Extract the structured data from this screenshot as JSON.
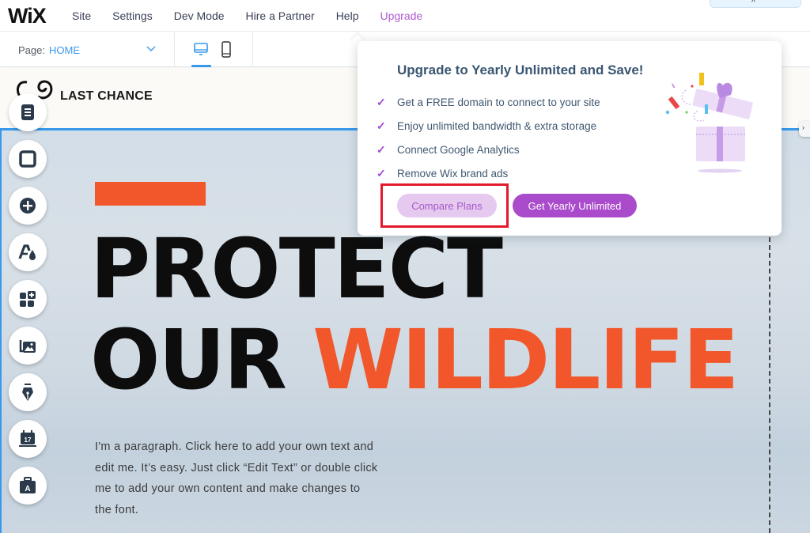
{
  "topbar": {
    "logo": "WiX",
    "menu": [
      {
        "label": "Site"
      },
      {
        "label": "Settings"
      },
      {
        "label": "Dev Mode"
      },
      {
        "label": "Hire a Partner"
      },
      {
        "label": "Help"
      },
      {
        "label": "Upgrade"
      }
    ],
    "collapse_icon": "chevron-up"
  },
  "secondbar": {
    "page_label": "Page:",
    "page_value": "HOME",
    "devices": [
      {
        "name": "desktop",
        "active": true
      },
      {
        "name": "mobile",
        "active": false
      }
    ]
  },
  "site": {
    "name": "LAST CHANCE",
    "headline_line1": "PROTECT",
    "headline_line2_word1": "OUR",
    "headline_line2_word2": "WILDLIFE",
    "paragraph": "I'm a paragraph. Click here to add your own text and edit me. It’s easy. Just click “Edit Text” or double click me to add your own content and make changes to the font.",
    "accent_color": "#f1572b"
  },
  "left_tools": [
    {
      "name": "menus-pages"
    },
    {
      "name": "background"
    },
    {
      "name": "add"
    },
    {
      "name": "theme"
    },
    {
      "name": "add-apps"
    },
    {
      "name": "media"
    },
    {
      "name": "blog"
    },
    {
      "name": "bookings"
    },
    {
      "name": "portfolio"
    }
  ],
  "popup": {
    "title": "Upgrade to Yearly Unlimited and Save!",
    "features": [
      "Get a FREE domain to connect to your site",
      "Enjoy unlimited bandwidth & extra storage",
      "Connect Google Analytics",
      "Remove Wix brand ads"
    ],
    "check_glyph": "✓",
    "compare_label": "Compare Plans",
    "get_label": "Get Yearly Unlimited",
    "brand_color": "#a94bcb"
  },
  "right_tab_glyph": "›"
}
